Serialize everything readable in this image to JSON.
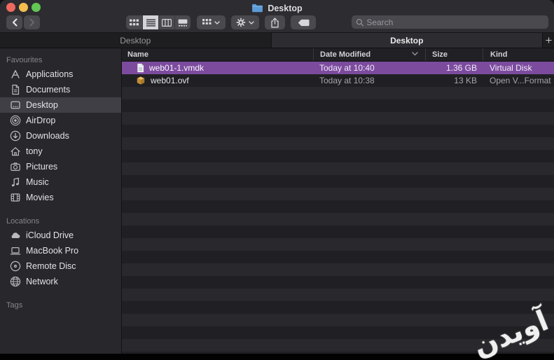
{
  "window_title": {
    "label": "Desktop",
    "icon": "folder-icon"
  },
  "toolbar": {
    "search_placeholder": "Search",
    "view_modes": [
      "icon",
      "list",
      "column",
      "gallery"
    ],
    "selected_view_mode": "list"
  },
  "tab_bar": {
    "tabs": [
      {
        "label": "Desktop"
      },
      {
        "label": "Desktop"
      }
    ],
    "active_tab_index": 1,
    "new_tab_label": "+"
  },
  "sidebar": {
    "sections": [
      {
        "title": "Favourites",
        "items": [
          {
            "label": "Applications",
            "icon": "applications-icon"
          },
          {
            "label": "Documents",
            "icon": "document-icon"
          },
          {
            "label": "Desktop",
            "icon": "desktop-icon",
            "selected": true
          },
          {
            "label": "AirDrop",
            "icon": "airdrop-icon"
          },
          {
            "label": "Downloads",
            "icon": "downloads-icon"
          },
          {
            "label": "tony",
            "icon": "home-icon"
          },
          {
            "label": "Pictures",
            "icon": "camera-icon"
          },
          {
            "label": "Music",
            "icon": "music-note-icon"
          },
          {
            "label": "Movies",
            "icon": "film-icon"
          }
        ]
      },
      {
        "title": "Locations",
        "items": [
          {
            "label": "iCloud Drive",
            "icon": "cloud-icon"
          },
          {
            "label": "MacBook Pro",
            "icon": "laptop-icon"
          },
          {
            "label": "Remote Disc",
            "icon": "disc-icon"
          },
          {
            "label": "Network",
            "icon": "globe-icon"
          }
        ]
      },
      {
        "title": "Tags",
        "items": []
      }
    ]
  },
  "file_list": {
    "columns": {
      "name": "Name",
      "date_modified": "Date Modified",
      "size": "Size",
      "kind": "Kind"
    },
    "sort": {
      "column": "Date Modified",
      "direction": "desc"
    },
    "rows": [
      {
        "name": "web01-1.vmdk",
        "date_modified": "Today at 10:40",
        "size": "1.36 GB",
        "kind": "Virtual Disk",
        "selected": true,
        "icon": "document-file-icon"
      },
      {
        "name": "web01.ovf",
        "date_modified": "Today at 10:38",
        "size": "13 KB",
        "kind": "Open V...Format",
        "selected": false,
        "icon": "package-icon"
      }
    ]
  },
  "colors": {
    "selection_purple": "#7c4b9e",
    "traffic_close": "#ee6a5f",
    "traffic_minimize": "#f5bf4f",
    "traffic_zoom": "#62c554",
    "folder_blue": "#5b9bd6",
    "package_orange": "#dfa94f"
  },
  "watermark": {
    "text": "آویدن"
  }
}
